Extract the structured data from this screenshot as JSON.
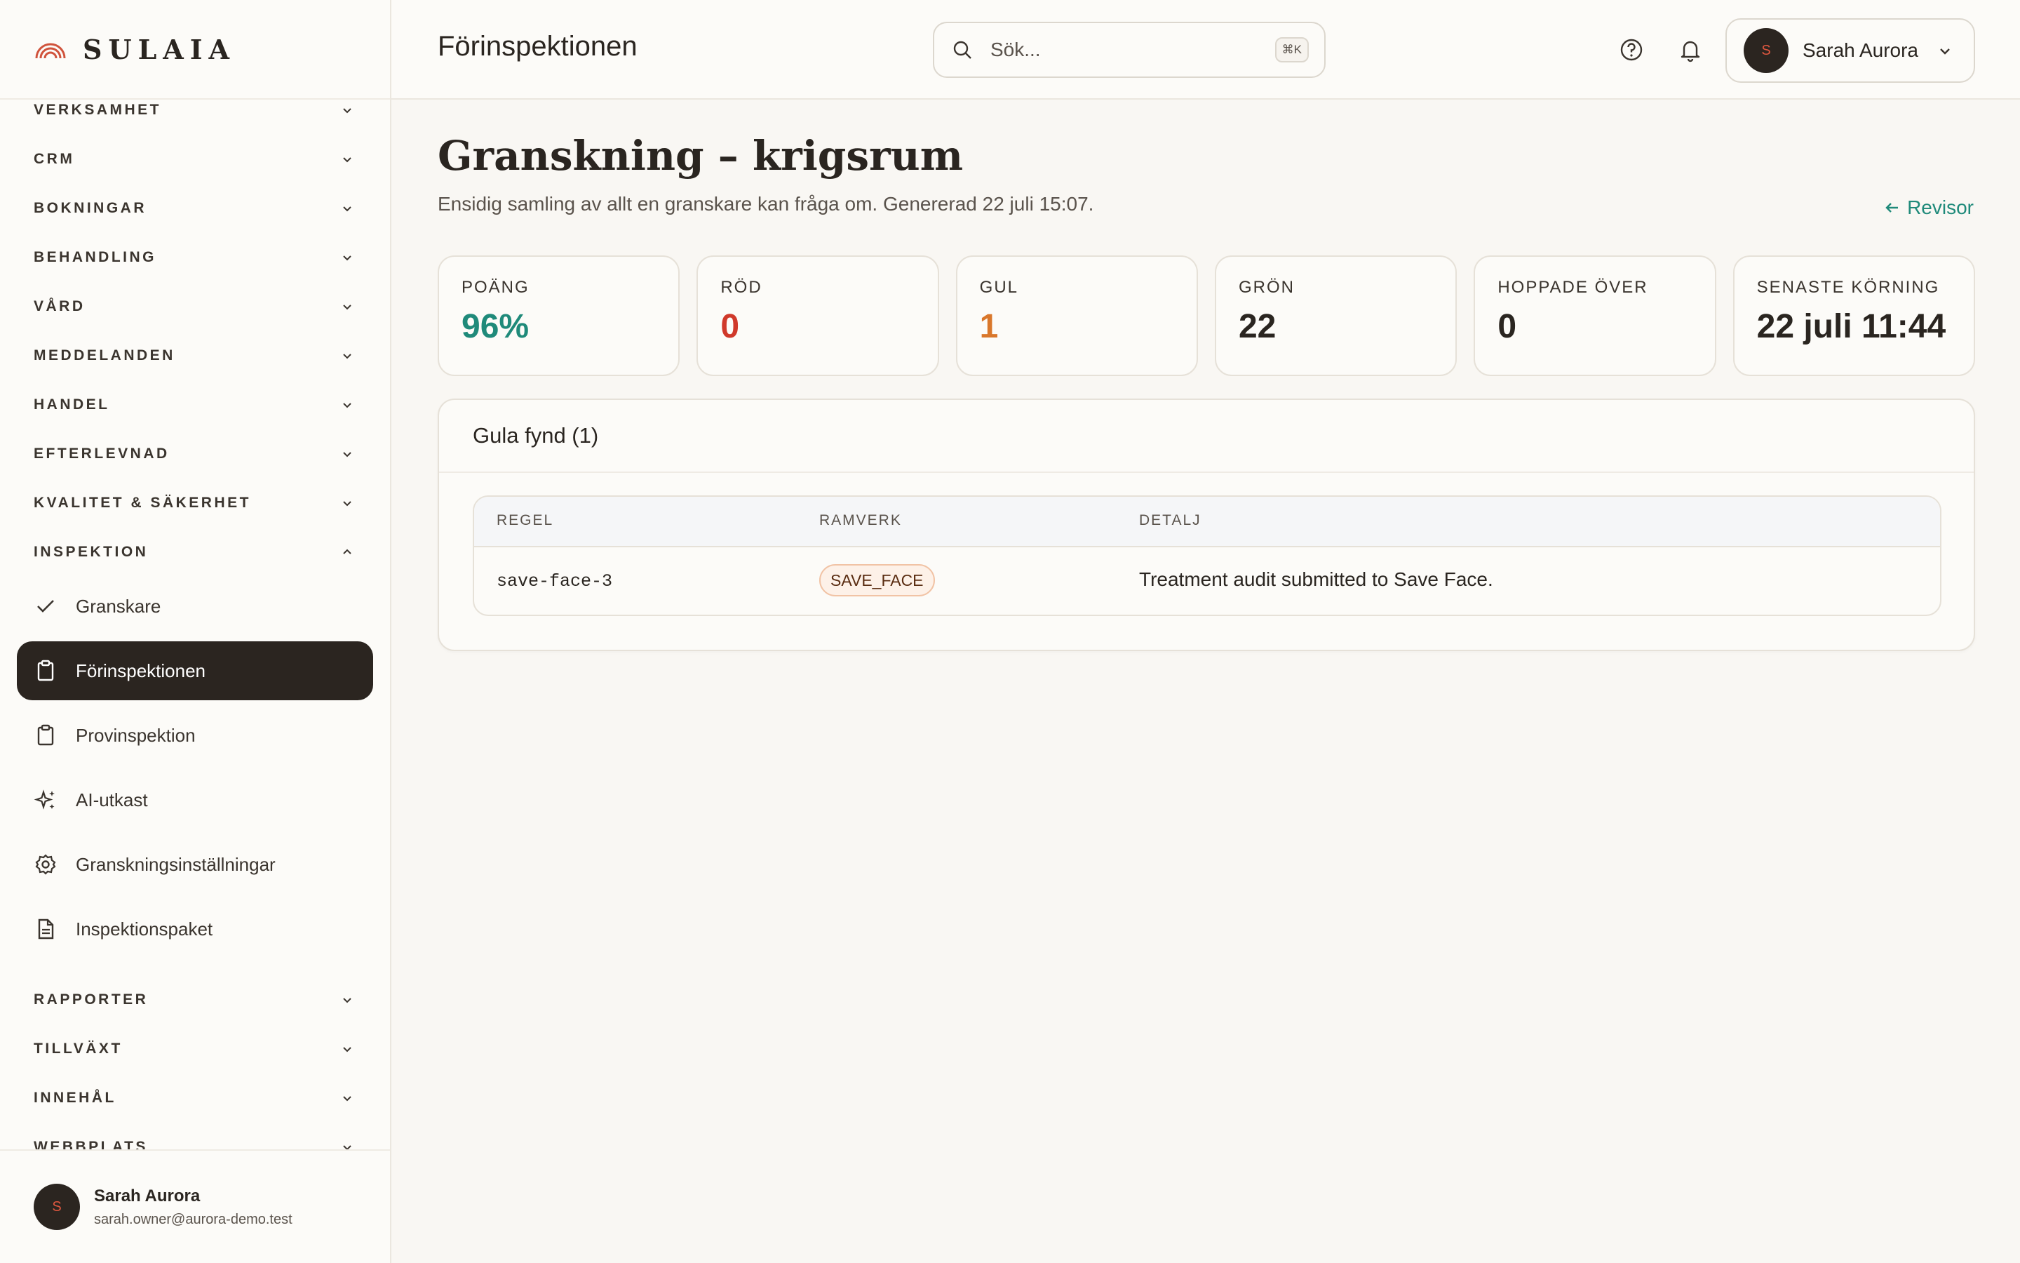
{
  "brand": {
    "name": "SULAIA"
  },
  "sidebar": {
    "sections_top": [
      {
        "label": "VERKSAMHET"
      },
      {
        "label": "CRM"
      },
      {
        "label": "BOKNINGAR"
      },
      {
        "label": "BEHANDLING"
      },
      {
        "label": "VÅRD"
      },
      {
        "label": "MEDDELANDEN"
      },
      {
        "label": "HANDEL"
      },
      {
        "label": "EFTERLEVNAD"
      },
      {
        "label": "KVALITET & SÄKERHET"
      }
    ],
    "inspektion": {
      "label": "INSPEKTION",
      "items": [
        {
          "label": "Granskare",
          "icon": "check-icon"
        },
        {
          "label": "Förinspektionen",
          "icon": "clipboard-icon",
          "active": true
        },
        {
          "label": "Provinspektion",
          "icon": "clipboard-icon"
        },
        {
          "label": "AI-utkast",
          "icon": "sparkles-icon"
        },
        {
          "label": "Granskningsinställningar",
          "icon": "gear-icon"
        },
        {
          "label": "Inspektionspaket",
          "icon": "document-icon"
        }
      ]
    },
    "sections_bottom": [
      {
        "label": "RAPPORTER"
      },
      {
        "label": "TILLVÄXT"
      },
      {
        "label": "INNEHÅL"
      },
      {
        "label": "WEBBPLATS"
      }
    ],
    "user": {
      "initial": "S",
      "name": "Sarah Aurora",
      "email": "sarah.owner@aurora-demo.test"
    }
  },
  "topbar": {
    "title": "Förinspektionen",
    "search": {
      "placeholder": "Sök...",
      "shortcut": "⌘K"
    },
    "user": {
      "initial": "S",
      "name": "Sarah Aurora"
    }
  },
  "page": {
    "title": "Granskning – krigsrum",
    "subtitle": "Ensidig samling av allt en granskare kan fråga om. Genererad 22 juli 15:07.",
    "back_link": "Revisor"
  },
  "stats": [
    {
      "label": "POÄNG",
      "value": "96%",
      "color": "#1f8a7a"
    },
    {
      "label": "RÖD",
      "value": "0",
      "color": "#d0392b"
    },
    {
      "label": "GUL",
      "value": "1",
      "color": "#d9772b"
    },
    {
      "label": "GRÖN",
      "value": "22",
      "color": "#2a2520"
    },
    {
      "label": "HOPPADE ÖVER",
      "value": "0",
      "color": "#2a2520"
    },
    {
      "label": "SENASTE KÖRNING",
      "value": "22 juli 11:44",
      "color": "#2a2520"
    }
  ],
  "findings": {
    "title": "Gula fynd (1)",
    "columns": [
      "REGEL",
      "RAMVERK",
      "DETALJ"
    ],
    "rows": [
      {
        "rule": "save-face-3",
        "framework": "SAVE_FACE",
        "detail": "Treatment audit submitted to Save Face."
      }
    ]
  },
  "colors": {
    "accent": "#1f8a7a",
    "active_nav": "#2b2520",
    "brand_logo": "#d0533c"
  }
}
